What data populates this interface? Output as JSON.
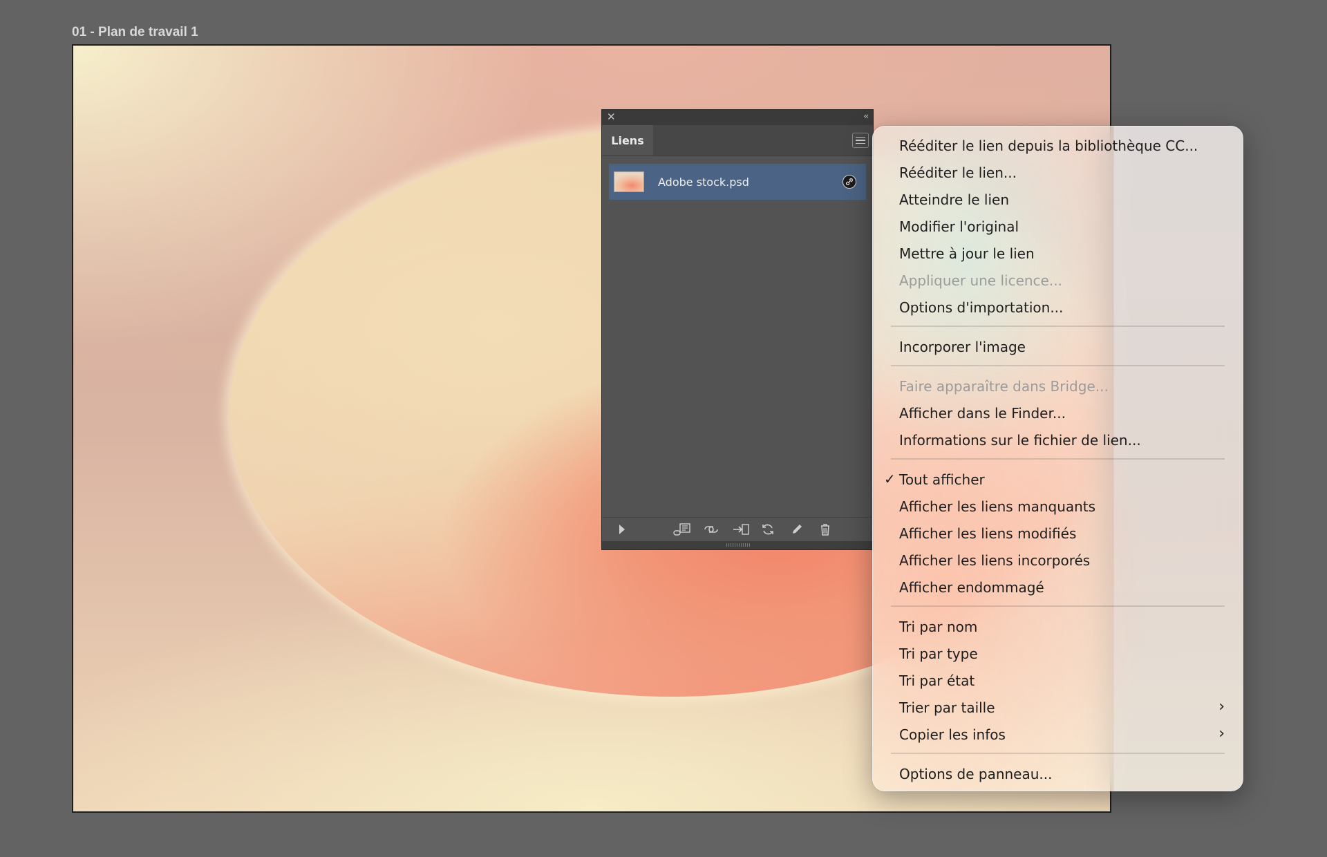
{
  "artboard": {
    "title": "01 - Plan de travail 1"
  },
  "links_panel": {
    "close_icon": "close-icon",
    "collapse_icon": "double-chevron-left-icon",
    "tab_label": "Liens",
    "menu_icon": "hamburger-menu-icon",
    "items": [
      {
        "name": "Adobe stock.psd",
        "status_icon": "cc-library-link-icon",
        "selected": true
      }
    ],
    "footer_buttons": [
      "play-icon",
      "relink-cc-library-icon",
      "relink-icon",
      "go-to-link-icon",
      "update-link-icon",
      "edit-original-icon",
      "delete-icon"
    ]
  },
  "context_menu": {
    "items": [
      {
        "label": "Rééditer le lien depuis la bibliothèque CC...",
        "enabled": true
      },
      {
        "label": "Rééditer le lien...",
        "enabled": true
      },
      {
        "label": "Atteindre le lien",
        "enabled": true
      },
      {
        "label": "Modifier l'original",
        "enabled": true
      },
      {
        "label": "Mettre à jour le lien",
        "enabled": true
      },
      {
        "label": "Appliquer une licence...",
        "enabled": false
      },
      {
        "label": "Options d'importation...",
        "enabled": true
      },
      {
        "label": "Incorporer l'image",
        "enabled": true
      },
      {
        "label": "Faire apparaître dans Bridge...",
        "enabled": false
      },
      {
        "label": "Afficher dans le Finder...",
        "enabled": true
      },
      {
        "label": "Informations sur le fichier de lien...",
        "enabled": true
      },
      {
        "label": "Tout afficher",
        "enabled": true,
        "checked": true
      },
      {
        "label": "Afficher les liens manquants",
        "enabled": true
      },
      {
        "label": "Afficher les liens modifiés",
        "enabled": true
      },
      {
        "label": "Afficher les liens incorporés",
        "enabled": true
      },
      {
        "label": "Afficher endommagé",
        "enabled": true
      },
      {
        "label": "Tri par nom",
        "enabled": true
      },
      {
        "label": "Tri par type",
        "enabled": true
      },
      {
        "label": "Tri par état",
        "enabled": true
      },
      {
        "label": "Trier par taille",
        "enabled": true,
        "submenu": true
      },
      {
        "label": "Copier les infos",
        "enabled": true,
        "submenu": true
      },
      {
        "label": "Options de panneau...",
        "enabled": true
      }
    ],
    "check_glyph": "✓",
    "submenu_glyph": "›"
  },
  "colors": {
    "workspace": "#636363",
    "panel": "#535353",
    "selection": "#4b6384",
    "disabled_text": "#9b9b9b"
  }
}
